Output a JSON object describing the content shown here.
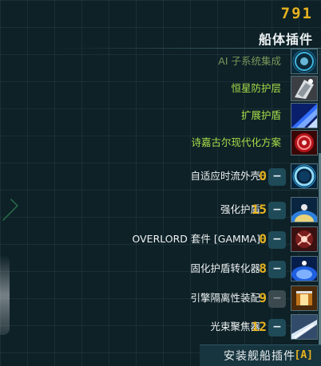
{
  "header": {
    "top_label": "",
    "credits": "791",
    "panel_title": "船体插件"
  },
  "plugins": [
    {
      "label": "AI 子系统集成",
      "state": "locked",
      "label_color": "#76985a",
      "icon": "ai-subsystem-icon"
    },
    {
      "label": "恒星防护层",
      "state": "unlocked",
      "label_color": "#a8df4a",
      "icon": "stellar-shield-icon"
    },
    {
      "label": "扩展护盾",
      "state": "unlocked",
      "label_color": "#a8df4a",
      "icon": "extended-shield-icon"
    },
    {
      "label": "诗嘉古尔现代化方案",
      "state": "unlocked",
      "label_color": "#a8df4a",
      "icon": "modernization-icon"
    },
    {
      "label": "自适应时流外壳",
      "state": "available",
      "qty": "0",
      "icon": "adaptive-timeflow-icon"
    },
    {
      "label": "强化护盾",
      "state": "available",
      "qty": "15",
      "icon": "reinforced-shield-icon"
    },
    {
      "label": "OVERLORD 套件 [GAMMA]",
      "state": "available",
      "qty": "0",
      "icon": "overlord-kit-icon"
    },
    {
      "label": "固化护盾转化器",
      "state": "available",
      "qty": "8",
      "icon": "shield-converter-icon"
    },
    {
      "label": "引擎隔离性装配",
      "state": "available",
      "qty": "9",
      "minus_disabled": true,
      "icon": "engine-isolation-icon"
    },
    {
      "label": "光束聚焦器",
      "state": "available",
      "qty": "12",
      "icon": "beam-focuser-icon"
    }
  ],
  "install": {
    "label": "安装舰船插件",
    "key": "[A]"
  },
  "minus_symbol": "−"
}
